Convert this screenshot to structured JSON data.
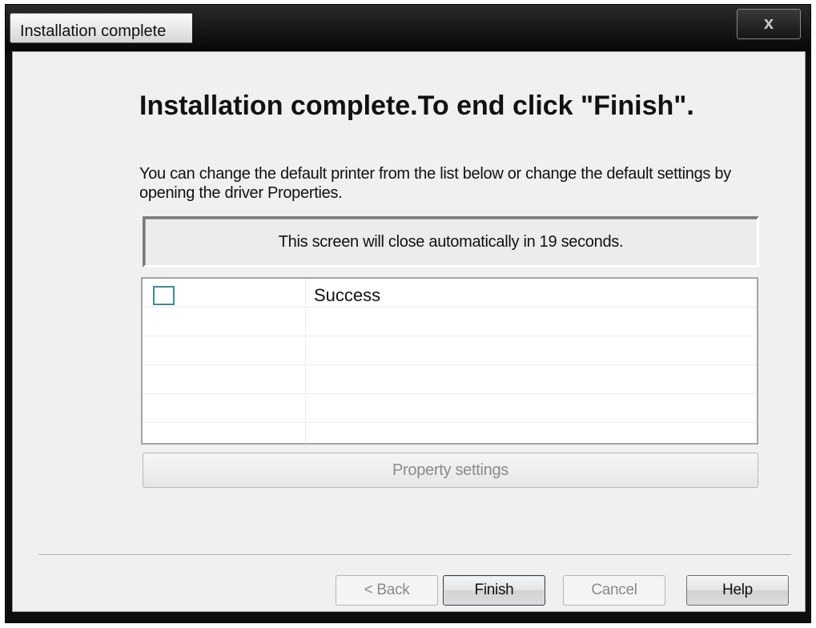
{
  "window": {
    "title": "Installation complete",
    "close_glyph": "x"
  },
  "content": {
    "heading": "Installation complete.To end click \"Finish\".",
    "description": "You can change the default printer from the list below or change the default settings by opening the driver Properties.",
    "countdown": "This screen will close automatically in 19 seconds."
  },
  "printer_list": {
    "rows": [
      {
        "checked": false,
        "status": "Success"
      }
    ],
    "empty_rows": 5
  },
  "buttons": {
    "property_settings": "Property settings",
    "back": "< Back",
    "finish": "Finish",
    "cancel": "Cancel",
    "help": "Help"
  },
  "colors": {
    "checkbox_border": "#3e8a9a",
    "disabled_text": "#8a8a8a"
  }
}
